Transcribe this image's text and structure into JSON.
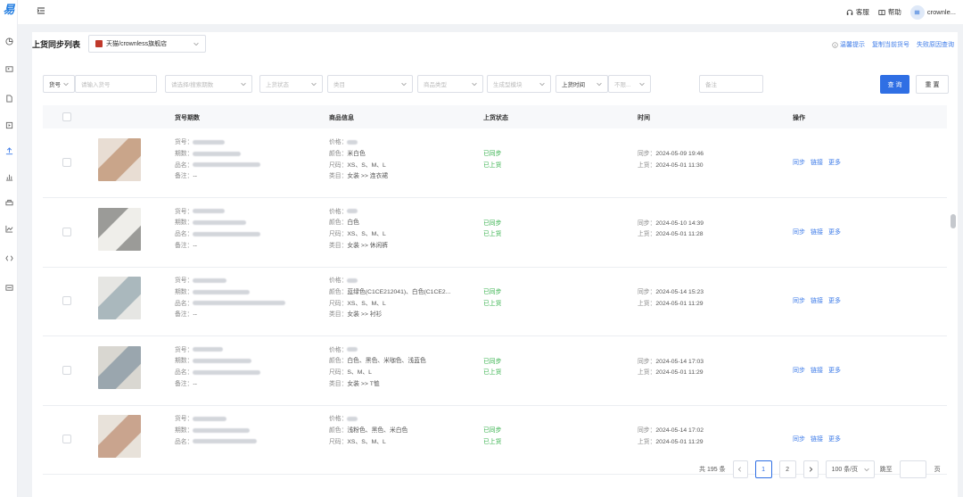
{
  "app": {
    "logo_text": "易"
  },
  "topbar": {
    "service_label": "客服",
    "help_label": "帮助",
    "user_name": "crownle..."
  },
  "page": {
    "title": "上货同步列表",
    "store_selected": "天猫/crownless旗舰店",
    "links": [
      "温馨提示",
      "复制当前货号",
      "失败原因查询"
    ]
  },
  "filters": {
    "field_select": "货号",
    "field_placeholder": "请输入货号",
    "period_placeholder": "请选择/搜索期数",
    "status_placeholder": "上货状态",
    "category_placeholder": "类目",
    "product_type_placeholder": "商品类型",
    "template_placeholder": "生成型模块",
    "time_select": "上货时间",
    "time_range_placeholder": "不限...",
    "remark_placeholder": "备注",
    "search_button": "查 询",
    "reset_button": "重 置"
  },
  "table": {
    "headers": [
      "货号期数",
      "商品信息",
      "上货状态",
      "时间",
      "操作"
    ],
    "labels": {
      "sku": "货号：",
      "period": "期数：",
      "name": "品名：",
      "remark": "备注：",
      "price": "价格：",
      "color": "颜色：",
      "size": "尺码：",
      "category": "类目：",
      "sync_time": "同步：",
      "upload_time": "上货："
    },
    "rows": [
      {
        "remark": "--",
        "color": "米白色",
        "size": "XS、S、M、L",
        "category": "女装 >> 连衣裙",
        "sync_status": "已同步",
        "upload_status": "已上货",
        "sync_time": "2024-05-09 19:46",
        "upload_time": "2024-05-01 11:30",
        "image_colors": [
          "#c9a58a",
          "#e8ddd3"
        ]
      },
      {
        "remark": "--",
        "color": "白色",
        "size": "XS、S、M、L",
        "category": "女装 >> 休闲裤",
        "sync_status": "已同步",
        "upload_status": "已上货",
        "sync_time": "2024-05-10 14:39",
        "upload_time": "2024-05-01 11:28",
        "image_colors": [
          "#efeeea",
          "#9b9b98"
        ]
      },
      {
        "remark": "--",
        "color": "蓝绿色(C1CE212041)、白色(C1CE2...",
        "size": "XS、S、M、L",
        "category": "女装 >> 衬衫",
        "sync_status": "已同步",
        "upload_status": "已上货",
        "sync_time": "2024-05-14 15:23",
        "upload_time": "2024-05-01 11:29",
        "image_colors": [
          "#aab8bd",
          "#e6e6e3"
        ]
      },
      {
        "remark": "--",
        "color": "白色、黑色、米咖色、浅蓝色",
        "size": "S、M、L",
        "category": "女装 >> T恤",
        "sync_status": "已同步",
        "upload_status": "已上货",
        "sync_time": "2024-05-14 17:03",
        "upload_time": "2024-05-01 11:29",
        "image_colors": [
          "#9aa6ae",
          "#d9d7d1"
        ]
      },
      {
        "remark": "",
        "color": "浅粉色、黑色、米白色",
        "size": "XS、S、M、L",
        "category": "",
        "sync_status": "已同步",
        "upload_status": "已上货",
        "sync_time": "2024-05-14 17:02",
        "upload_time": "2024-05-01 11:29",
        "image_colors": [
          "#c9a48e",
          "#e8e2da"
        ]
      }
    ],
    "ops": [
      "同步",
      "链接",
      "更多"
    ]
  },
  "pagination": {
    "total": "共 195 条",
    "pages": [
      "1",
      "2"
    ],
    "current": "1",
    "page_size": "100 条/页",
    "goto_label": "跳至",
    "page_unit": "页"
  }
}
